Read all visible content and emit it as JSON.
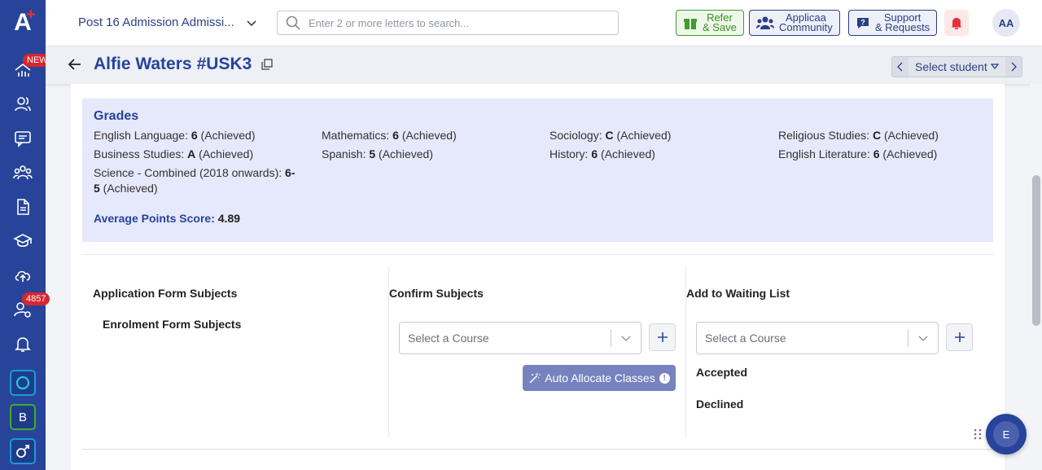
{
  "app": {
    "logo_letter": "A",
    "logo_plus": "+"
  },
  "sidebar": {
    "items": [
      {
        "name": "dashboard",
        "badge": "NEW"
      },
      {
        "name": "users"
      },
      {
        "name": "messages"
      },
      {
        "name": "groups"
      },
      {
        "name": "documents"
      },
      {
        "name": "courses"
      },
      {
        "name": "upload"
      },
      {
        "name": "user-settings",
        "badge": "4857"
      },
      {
        "name": "notifications"
      }
    ],
    "apps": [
      {
        "name": "app-o",
        "label": "",
        "color": "#1b9ad6"
      },
      {
        "name": "app-b",
        "label": "B",
        "color": "#3fae2a"
      },
      {
        "name": "app-gender",
        "label": "",
        "color": "#1b9ad6"
      }
    ]
  },
  "topbar": {
    "org_name": "Post 16 Admission Admissi...",
    "search_placeholder": "Enter 2 or more letters to search...",
    "refer_line1": "Refer",
    "refer_line2": "& Save",
    "community_line1": "Applicaa",
    "community_line2": "Community",
    "support_line1": "Support",
    "support_line2": "& Requests",
    "avatar_initials": "AA"
  },
  "student": {
    "name": "Alfie Waters",
    "id": "#USK3",
    "select_label": "Select student"
  },
  "grades": {
    "title": "Grades",
    "items": [
      {
        "subject": "English Language: ",
        "grade": "6",
        "status": " (Achieved)"
      },
      {
        "subject": "Mathematics: ",
        "grade": "6",
        "status": " (Achieved)"
      },
      {
        "subject": "Sociology: ",
        "grade": "C",
        "status": " (Achieved)"
      },
      {
        "subject": "Religious Studies: ",
        "grade": "C",
        "status": " (Achieved)"
      },
      {
        "subject": "Business Studies: ",
        "grade": "A",
        "status": " (Achieved)"
      },
      {
        "subject": "Spanish: ",
        "grade": "5",
        "status": " (Achieved)"
      },
      {
        "subject": "History: ",
        "grade": "6",
        "status": " (Achieved)"
      },
      {
        "subject": "English Literature: ",
        "grade": "6",
        "status": " (Achieved)"
      },
      {
        "subject": "Science - Combined (2018 onwards): ",
        "grade": "6-5",
        "status": " (Achieved)"
      }
    ],
    "aps_label": "Average Points Score: ",
    "aps_value": "4.89"
  },
  "subjects": {
    "application_heading": "Application Form Subjects",
    "enrolment_heading": "Enrolment Form Subjects",
    "confirm_heading": "Confirm Subjects",
    "waiting_heading": "Add to Waiting List",
    "course_placeholder": "Select a Course",
    "auto_allocate_label": "Auto Allocate Classes",
    "accepted_label": "Accepted",
    "declined_label": "Declined"
  },
  "chat": {
    "initial": "E"
  },
  "colors": {
    "brand": "#27449a",
    "accent_red": "#e8303a",
    "grades_bg": "#e6e8fb"
  }
}
